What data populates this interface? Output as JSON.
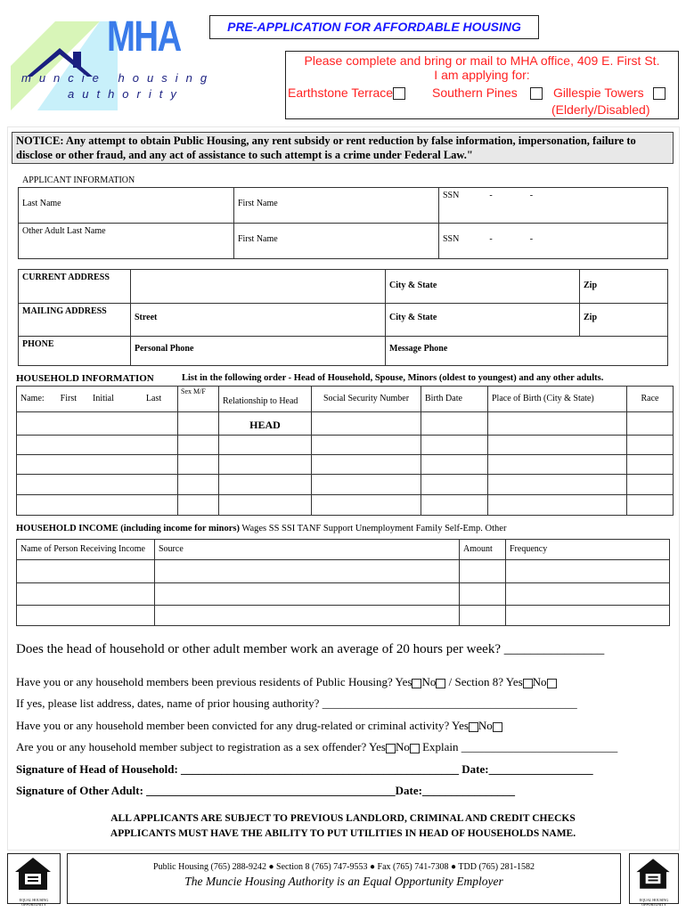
{
  "logo": {
    "letters": "MHA",
    "line1": "muncie housing",
    "line2": "authority",
    "colors": {
      "green": "#d8f5b8",
      "cyan": "#c8f0fa",
      "blue": "#3a7bea",
      "navy": "#1a1f80"
    }
  },
  "title": "PRE-APPLICATION FOR AFFORDABLE HOUSING",
  "instructions": {
    "line1": "Please complete and bring or mail to MHA office, 409 E. First St.",
    "line2": "I am applying for:",
    "options": [
      {
        "label": "Earthstone Terrace"
      },
      {
        "label": "Southern Pines"
      },
      {
        "label": "Gillespie Towers",
        "sub": "(Elderly/Disabled)"
      }
    ]
  },
  "notice": "NOTICE: Any attempt to obtain Public Housing, any rent subsidy or rent reduction by false information, impersonation, failure to disclose or other fraud, and any act of assistance to such attempt is a crime under Federal Law.\"",
  "applicant": {
    "heading": "APPLICANT INFORMATION",
    "last_name": "Last Name",
    "first_name": "First Name",
    "ssn": "SSN",
    "dash": "-",
    "other_adult": "Other Adult Last Name"
  },
  "address": {
    "current": "CURRENT ADDRESS",
    "mailing": "MAILING ADDRESS",
    "phone": "PHONE",
    "city_state": "City & State",
    "zip": "Zip",
    "street": "Street",
    "personal_phone": "Personal Phone",
    "message_phone": "Message Phone"
  },
  "household": {
    "heading": "HOUSEHOLD INFORMATION",
    "instruction": "List in the following order - Head of Household, Spouse, Minors (oldest to youngest) and any other adults.",
    "name": "Name:",
    "first": "First",
    "initial": "Initial",
    "last": "Last",
    "sex": "Sex M/F",
    "relationship": "Relationship to Head",
    "ssn": "Social Security Number",
    "birth": "Birth  Date",
    "place": "Place of Birth  (City & State)",
    "race": "Race",
    "head": "HEAD"
  },
  "income": {
    "heading": "HOUSEHOLD INCOME  (including income for minors)",
    "types": "Wages SS  SSI  TANF  Support  Unemployment   Family  Self-Emp. Other",
    "col_name": "Name of Person Receiving Income",
    "col_source": "Source",
    "col_amount": "Amount",
    "col_frequency": "Frequency"
  },
  "questions": {
    "q1": "Does the head of household or other adult member work an average of 20 hours per week? _______________",
    "q2a": "Have you or any household members been previous residents of Public Housing?  Yes",
    "no": "No",
    "yes": "Yes",
    "q2b": "  / Section 8?  Yes",
    "q3": "If yes, please list address, dates, name of prior housing authority? ____________________________________________",
    "q4": "Have you or any household member been convicted for any drug-related or criminal activity? Yes",
    "q5": "Are you or any household member subject to registration as a sex offender? Yes",
    "q5b": "   Explain ___________________________",
    "sig1": "Signature of Head of Household: ________________________________________________ Date:__________________",
    "sig2": "Signature of Other Adult:  ___________________________________________Date:________________"
  },
  "disclaimer": {
    "line1": "ALL APPLICANTS ARE SUBJECT TO PREVIOUS LANDLORD, CRIMINAL AND CREDIT CHECKS",
    "line2": "APPLICANTS MUST HAVE THE ABILITY TO PUT UTILITIES IN HEAD OF HOUSEHOLDS NAME."
  },
  "footer": {
    "contacts": "Public Housing (765) 288-9242 ● Section 8 (765) 747-9553 ● Fax (765) 741-7308 ● TDD (765) 281-1582",
    "eoe": "The Muncie Housing Authority is an Equal Opportunity Employer",
    "eho_label": "EQUAL HOUSING OPPORTUNITY"
  }
}
